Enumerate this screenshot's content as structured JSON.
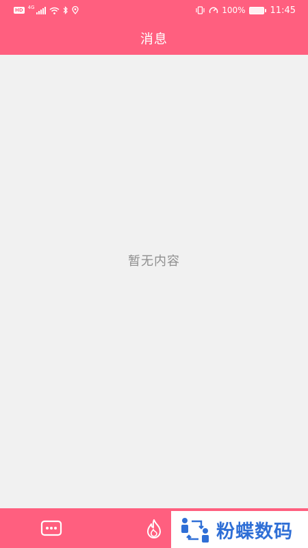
{
  "status_bar": {
    "hd_badge": "HD",
    "network": "4G",
    "battery_percent": "100%",
    "time": "11:45",
    "icons": [
      "hd-icon",
      "signal-icon",
      "wifi-icon",
      "bluetooth-icon",
      "location-icon",
      "vibrate-icon",
      "speedometer-icon",
      "battery-icon"
    ]
  },
  "header": {
    "title": "消息"
  },
  "content": {
    "empty_text": "暂无内容"
  },
  "bottom_bar": {
    "tabs": [
      {
        "icon": "chat-bubble-icon"
      },
      {
        "icon": "flame-icon"
      }
    ]
  },
  "watermark": {
    "text": "粉蝶数码"
  },
  "colors": {
    "brand": "#ff5f7f",
    "background": "#f1f1f1",
    "empty_text": "#8f8f8f",
    "watermark_text": "#2f6fd6"
  }
}
